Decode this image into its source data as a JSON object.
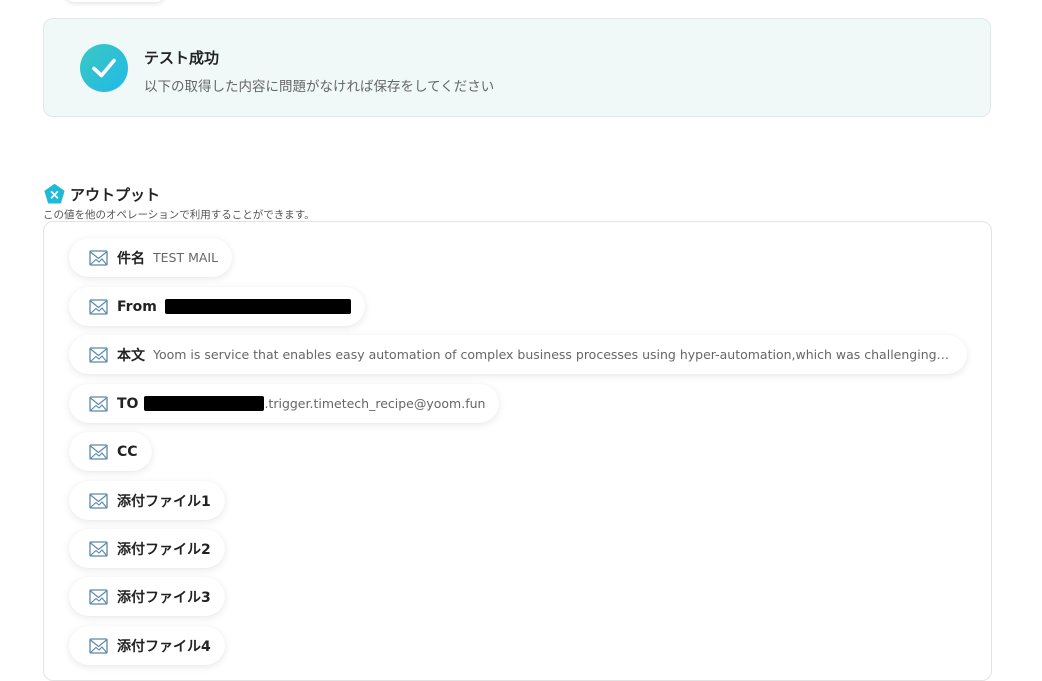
{
  "success": {
    "title": "テスト成功",
    "subtitle": "以下の取得した内容に問題がなければ保存をしてください"
  },
  "output": {
    "title": "アウトプット",
    "subtitle": "この値を他のオペレーションで利用することができます。"
  },
  "items": [
    {
      "label": "件名",
      "value": "TEST MAIL"
    },
    {
      "label": "From",
      "value": ""
    },
    {
      "label": "本文",
      "value": "Yoom is service that enables easy automation of complex business processes using hyper-automation,which was challenging for tradi…"
    },
    {
      "label": "TO",
      "value": ".trigger.timetech_recipe@yoom.fun"
    },
    {
      "label": "CC",
      "value": ""
    },
    {
      "label": "添付ファイル1",
      "value": ""
    },
    {
      "label": "添付ファイル2",
      "value": ""
    },
    {
      "label": "添付ファイル3",
      "value": ""
    },
    {
      "label": "添付ファイル4",
      "value": ""
    }
  ],
  "icons": {
    "success": "check-icon",
    "output": "output-badge-icon",
    "item": "mail-image-icon"
  },
  "colors": {
    "accent": "#22b8d8",
    "banner_bg": "#f0f9f8"
  }
}
